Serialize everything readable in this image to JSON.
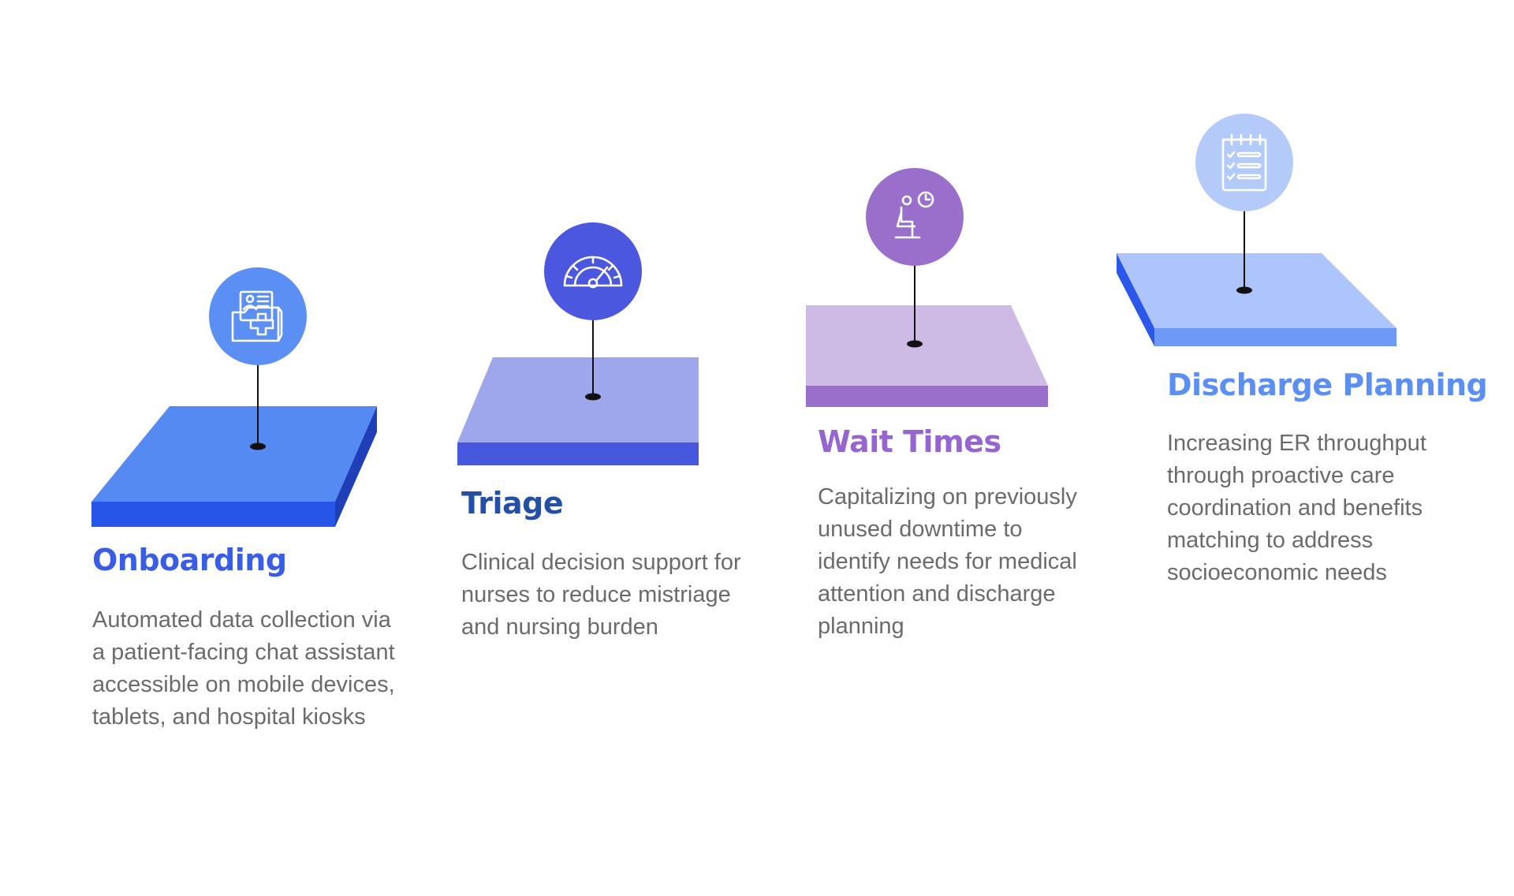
{
  "steps": [
    {
      "title": "Onboarding",
      "title_color": "#3a5de6",
      "icon": "medical-folder-icon",
      "description": [
        "Automated data collection via",
        "a patient-facing chat assistant",
        "accessible on mobile devices,",
        "tablets, and hospital kiosks"
      ],
      "colors": {
        "top": "#558af2",
        "front": "#2655e8",
        "side": "#1f3fb8",
        "circle": "#5b8ff3"
      }
    },
    {
      "title": "Triage",
      "title_color": "#234fa6",
      "icon": "speedometer-gauge-icon",
      "description": [
        "Clinical decision support for",
        "nurses to reduce mistriage",
        "and nursing burden"
      ],
      "colors": {
        "top": "#9fa7ec",
        "front": "#4558de",
        "circle": "#4a57de"
      }
    },
    {
      "title": "Wait Times",
      "title_color": "#9665cf",
      "icon": "waiting-patient-clock-icon",
      "description": [
        "Capitalizing on previously",
        "unused downtime to",
        "identify needs for medical",
        "attention and discharge",
        "planning"
      ],
      "colors": {
        "top": "#cdbbe6",
        "front": "#9a6fcc",
        "circle": "#9a6fcc"
      }
    },
    {
      "title": "Discharge Planning",
      "title_color": "#5b8ff3",
      "icon": "checklist-clipboard-icon",
      "description": [
        "Increasing ER throughput",
        "through proactive care",
        "coordination and benefits",
        "matching to address",
        "socioeconomic needs"
      ],
      "colors": {
        "top": "#aec5fb",
        "front": "#6e99f6",
        "side": "#2b58ea",
        "circle": "#b4caf9"
      }
    }
  ]
}
